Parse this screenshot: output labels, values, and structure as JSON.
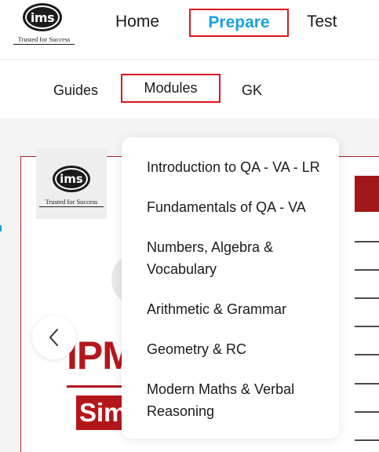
{
  "brand": {
    "logo_text": "ims",
    "tagline": "Trusted for Success"
  },
  "top_nav": {
    "items": [
      {
        "label": "Home"
      },
      {
        "label": "Prepare"
      },
      {
        "label": "Test"
      }
    ],
    "active": "Prepare",
    "active_color": "#1aa0e0",
    "highlight_color": "#e0161b"
  },
  "sub_nav": {
    "items": [
      {
        "label": "Guides"
      },
      {
        "label": "Modules"
      },
      {
        "label": "GK"
      }
    ],
    "active": "Modules"
  },
  "modules_menu": {
    "items": [
      {
        "label": "Introduction to QA - VA - LR"
      },
      {
        "label": "Fundamentals of QA - VA"
      },
      {
        "label": "Numbers, Algebra & Vocabulary"
      },
      {
        "label": "Arithmetic & Grammar"
      },
      {
        "label": "Geometry & RC"
      },
      {
        "label": "Modern Maths & Verbal Reasoning"
      }
    ]
  },
  "background_card": {
    "logo_text": "ims",
    "tagline": "Trusted for Success",
    "heading_fragment": "IPM",
    "subheading_fragment": "Sim",
    "accent_color": "#b3171c"
  },
  "carousel": {
    "prev_icon": "chevron-left-icon"
  }
}
